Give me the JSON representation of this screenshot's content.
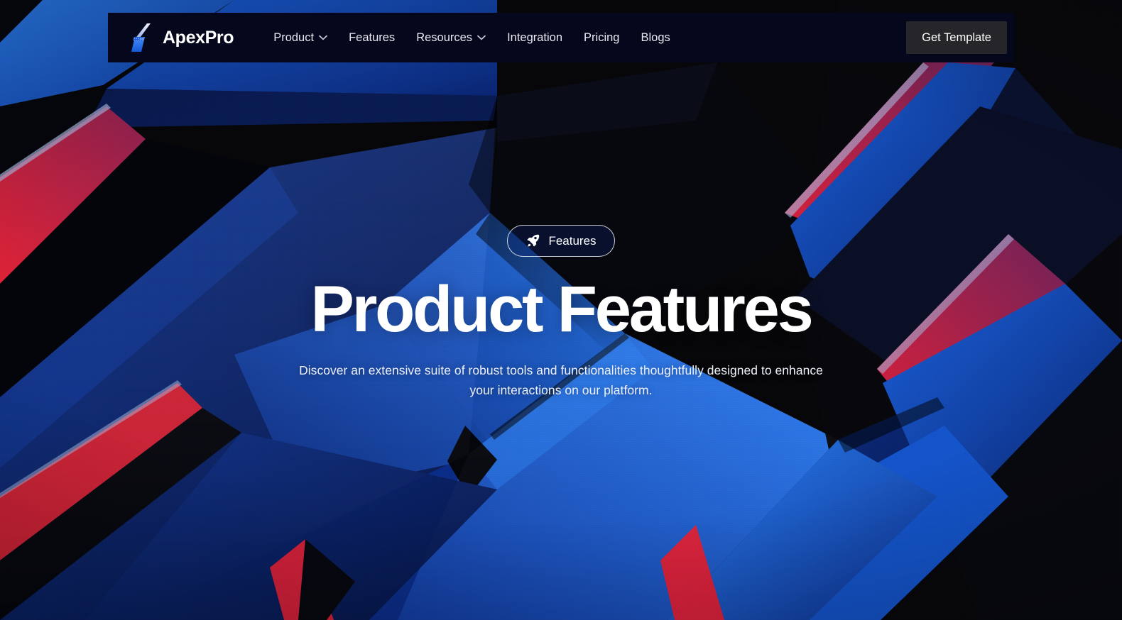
{
  "brand": {
    "name": "ApexPro",
    "logo_icon": "lightning-bolt-icon"
  },
  "nav": {
    "items": [
      {
        "label": "Product",
        "has_dropdown": true,
        "icon": "chevron-down-icon"
      },
      {
        "label": "Features",
        "has_dropdown": false,
        "icon": ""
      },
      {
        "label": "Resources",
        "has_dropdown": true,
        "icon": "chevron-down-icon"
      },
      {
        "label": "Integration",
        "has_dropdown": false,
        "icon": ""
      },
      {
        "label": "Pricing",
        "has_dropdown": false,
        "icon": ""
      },
      {
        "label": "Blogs",
        "has_dropdown": false,
        "icon": ""
      }
    ],
    "cta_label": "Get Template"
  },
  "hero": {
    "badge_label": "Features",
    "badge_icon": "rocket-icon",
    "title": "Product Features",
    "subtitle": "Discover an extensive suite of robust tools and functionalities thoughtfully designed to enhance your interactions on our platform."
  },
  "colors": {
    "page_background": "#07070a",
    "navbar_background": "#05081c",
    "cta_background": "#262529",
    "text_primary": "#ffffff",
    "nav_link": "#e9e7ef",
    "accent_blue": "#1549c8",
    "accent_bright_blue": "#1f6fe8",
    "accent_red": "#cf2039",
    "deep_navy": "#0a1333"
  }
}
